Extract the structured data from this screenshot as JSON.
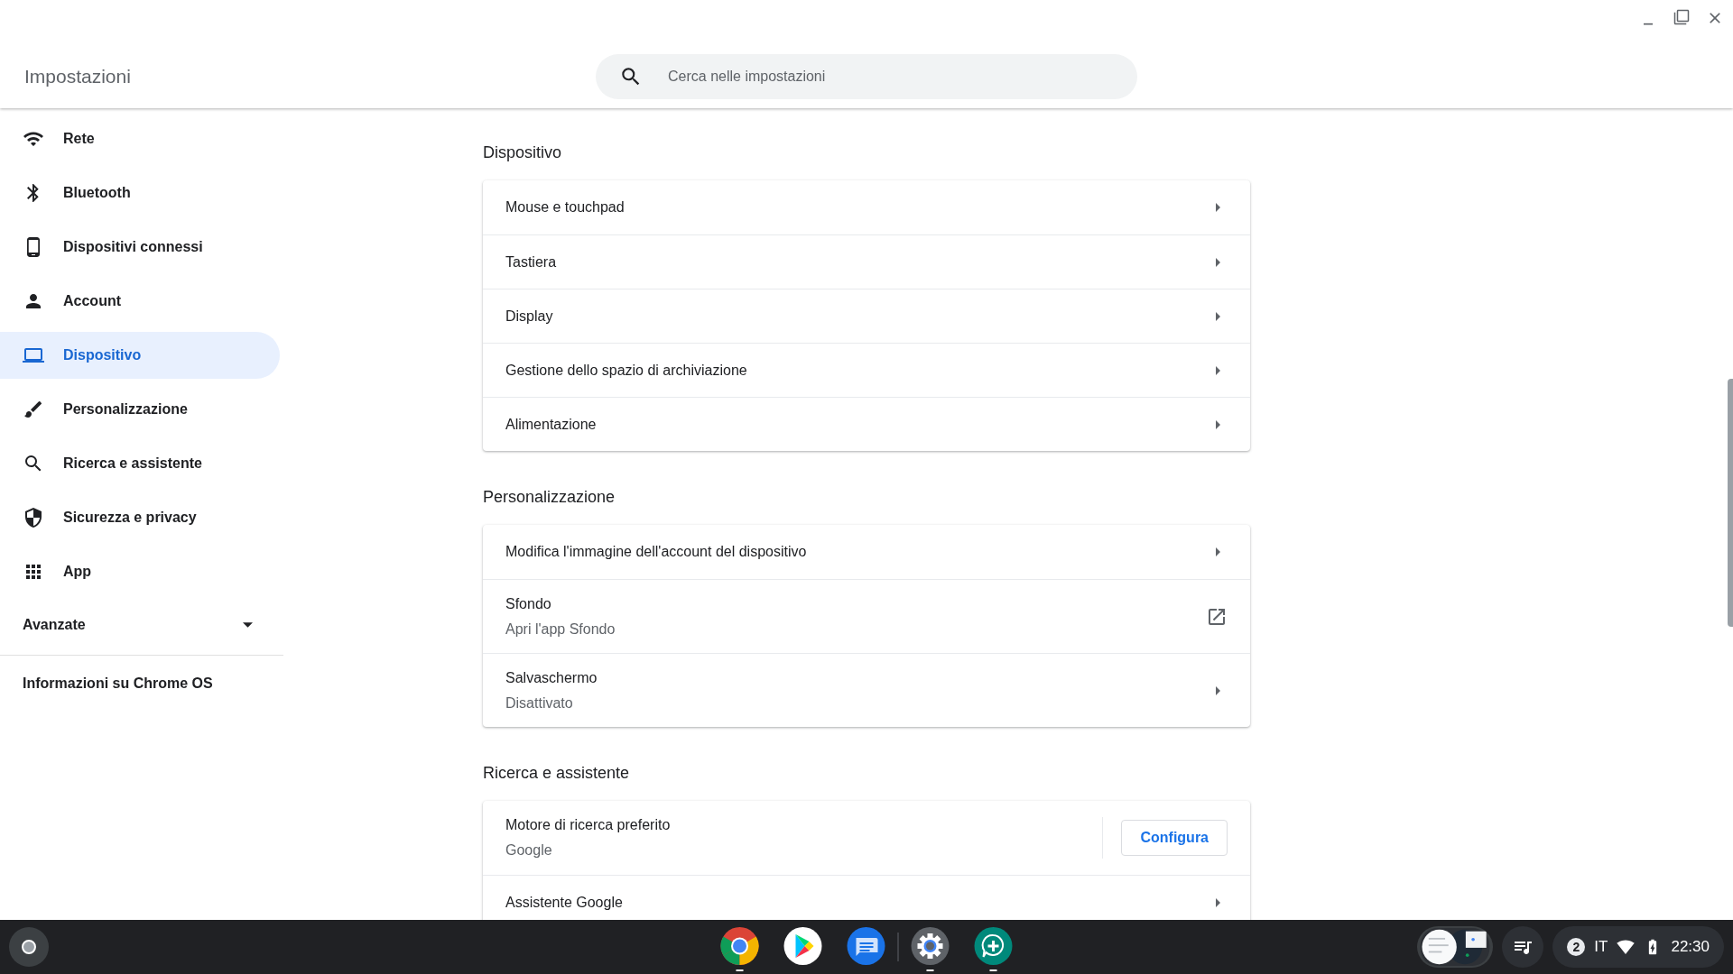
{
  "window": {
    "title": "Impostazioni"
  },
  "search": {
    "placeholder": "Cerca nelle impostazioni"
  },
  "sidebar": {
    "items": [
      {
        "label": "Rete",
        "selected": false
      },
      {
        "label": "Bluetooth",
        "selected": false
      },
      {
        "label": "Dispositivi connessi",
        "selected": false
      },
      {
        "label": "Account",
        "selected": false
      },
      {
        "label": "Dispositivo",
        "selected": true
      },
      {
        "label": "Personalizzazione",
        "selected": false
      },
      {
        "label": "Ricerca e assistente",
        "selected": false
      },
      {
        "label": "Sicurezza e privacy",
        "selected": false
      },
      {
        "label": "App",
        "selected": false
      }
    ],
    "advanced": {
      "label": "Avanzate",
      "expanded": false
    },
    "about": "Informazioni su Chrome OS"
  },
  "sections": [
    {
      "title": "Dispositivo",
      "rows": [
        {
          "kind": "link",
          "label": "Mouse e touchpad"
        },
        {
          "kind": "link",
          "label": "Tastiera"
        },
        {
          "kind": "link",
          "label": "Display"
        },
        {
          "kind": "link",
          "label": "Gestione dello spazio di archiviazione"
        },
        {
          "kind": "link",
          "label": "Alimentazione"
        }
      ]
    },
    {
      "title": "Personalizzazione",
      "rows": [
        {
          "kind": "link",
          "label": "Modifica l'immagine dell'account del dispositivo"
        },
        {
          "kind": "external",
          "label": "Sfondo",
          "sublabel": "Apri l'app Sfondo"
        },
        {
          "kind": "link",
          "label": "Salvaschermo",
          "sublabel": "Disattivato"
        }
      ]
    },
    {
      "title": "Ricerca e assistente",
      "rows": [
        {
          "kind": "button",
          "label": "Motore di ricerca preferito",
          "sublabel": "Google",
          "button": "Configura"
        },
        {
          "kind": "link",
          "label": "Assistente Google"
        }
      ]
    }
  ],
  "shelf": {
    "apps": [
      {
        "running": true
      },
      {
        "running": false
      },
      {
        "running": false
      },
      {
        "running": true
      },
      {
        "running": true
      }
    ]
  },
  "tray": {
    "notifications": "2",
    "keyboard": "IT",
    "time": "22:30"
  }
}
